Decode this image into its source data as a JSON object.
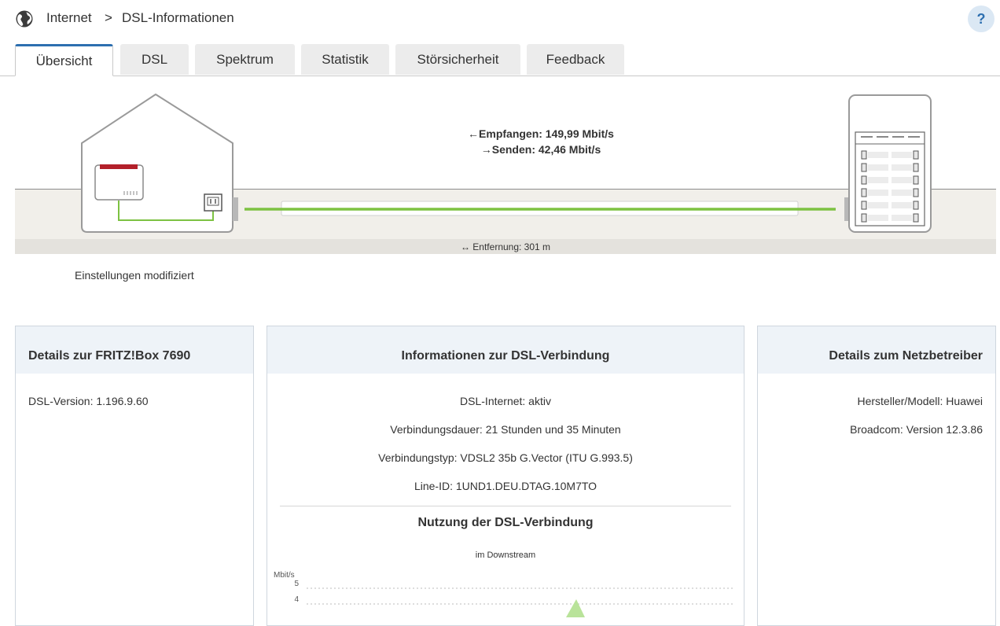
{
  "breadcrumb": {
    "section": "Internet",
    "separator": ">",
    "page": "DSL-Informationen"
  },
  "help": {
    "label": "?"
  },
  "tabs": [
    {
      "label": "Übersicht",
      "active": true
    },
    {
      "label": "DSL",
      "active": false
    },
    {
      "label": "Spektrum",
      "active": false
    },
    {
      "label": "Statistik",
      "active": false
    },
    {
      "label": "Störsicherheit",
      "active": false
    },
    {
      "label": "Feedback",
      "active": false
    }
  ],
  "diagram": {
    "receive": "Empfangen: 149,99 Mbit/s",
    "send": "Senden: 42,46 Mbit/s",
    "distance": "Entfernung: 301 m",
    "settings_note": "Einstellungen modifiziert",
    "line_color": "#7dc242",
    "router_accent": "#b3202a"
  },
  "panels": {
    "fritzbox": {
      "title": "Details zur FRITZ!Box 7690",
      "rows": [
        "DSL-Version: 1.196.9.60"
      ]
    },
    "dsl": {
      "title": "Informationen zur DSL-Verbindung",
      "rows": [
        "DSL-Internet: aktiv",
        "Verbindungsdauer: 21 Stunden und 35 Minuten",
        "Verbindungstyp: VDSL2 35b G.Vector (ITU G.993.5)",
        "Line-ID: 1UND1.DEU.DTAG.10M7TO"
      ],
      "usage_title": "Nutzung der DSL-Verbindung",
      "usage_sub": "im Downstream"
    },
    "provider": {
      "title": "Details zum Netzbetreiber",
      "rows": [
        "Hersteller/Modell: Huawei",
        "Broadcom: Version 12.3.86"
      ]
    }
  },
  "chart_data": {
    "type": "area",
    "title": "Nutzung der DSL-Verbindung",
    "subtitle": "im Downstream",
    "ylabel": "Mbit/s",
    "yticks": [
      "5",
      "4"
    ],
    "ylim": [
      0,
      5
    ],
    "grid": true,
    "series_color": "#7dc242"
  }
}
